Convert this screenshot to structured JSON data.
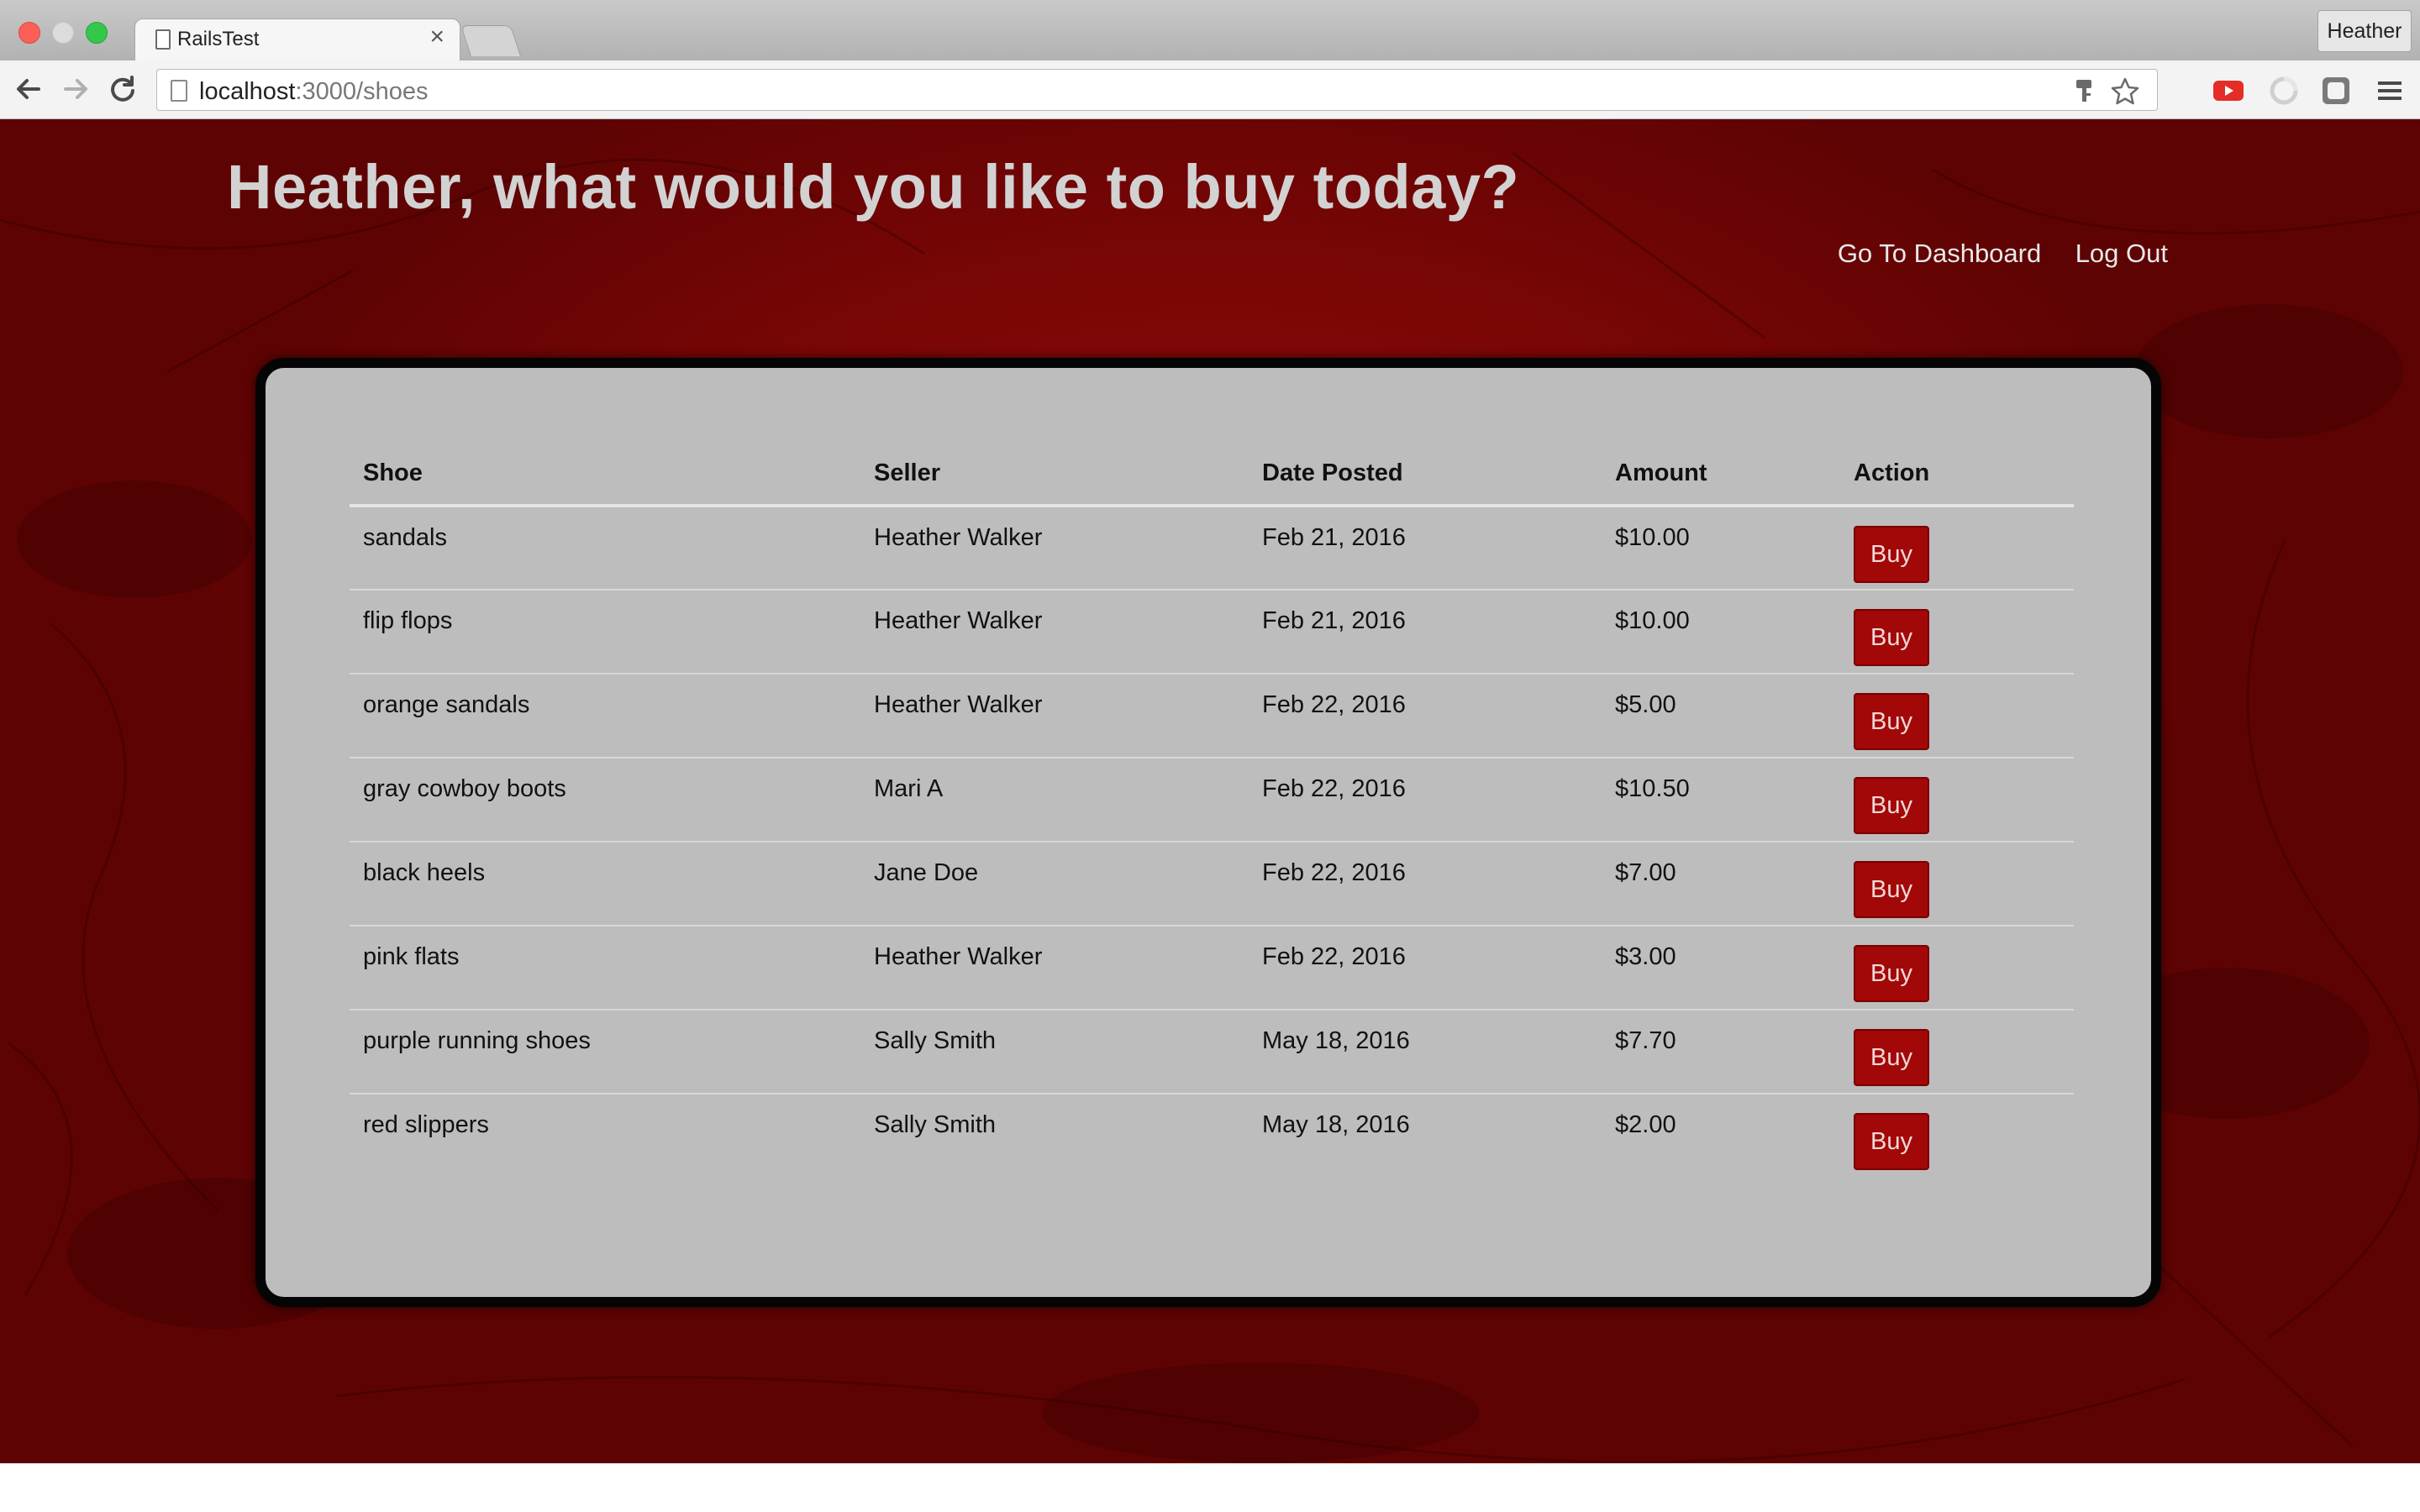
{
  "browser": {
    "tab_title": "RailsTest",
    "tab_close": "×",
    "profile_name": "Heather",
    "url_host": "localhost",
    "url_path": ":3000/shoes"
  },
  "page": {
    "heading": "Heather, what would you like to buy today?",
    "nav": {
      "dashboard": "Go To Dashboard",
      "logout": "Log Out"
    },
    "table": {
      "headers": [
        "Shoe",
        "Seller",
        "Date Posted",
        "Amount",
        "Action"
      ],
      "rows": [
        {
          "shoe": "sandals",
          "seller": "Heather Walker",
          "date": "Feb 21, 2016",
          "amount": "$10.00",
          "action": "Buy"
        },
        {
          "shoe": "flip flops",
          "seller": "Heather Walker",
          "date": "Feb 21, 2016",
          "amount": "$10.00",
          "action": "Buy"
        },
        {
          "shoe": "orange sandals",
          "seller": "Heather Walker",
          "date": "Feb 22, 2016",
          "amount": "$5.00",
          "action": "Buy"
        },
        {
          "shoe": "gray cowboy boots",
          "seller": "Mari A",
          "date": "Feb 22, 2016",
          "amount": "$10.50",
          "action": "Buy"
        },
        {
          "shoe": "black heels",
          "seller": "Jane Doe",
          "date": "Feb 22, 2016",
          "amount": "$7.00",
          "action": "Buy"
        },
        {
          "shoe": "pink flats",
          "seller": "Heather Walker",
          "date": "Feb 22, 2016",
          "amount": "$3.00",
          "action": "Buy"
        },
        {
          "shoe": "purple running shoes",
          "seller": "Sally Smith",
          "date": "May 18, 2016",
          "amount": "$7.70",
          "action": "Buy"
        },
        {
          "shoe": "red slippers",
          "seller": "Sally Smith",
          "date": "May 18, 2016",
          "amount": "$2.00",
          "action": "Buy"
        }
      ]
    }
  },
  "colors": {
    "background": "#7a0606",
    "panel": "#bdbdbd",
    "panel_border": "#050505",
    "buy_button": "#a30808",
    "heading": "#d2d2d2"
  },
  "icons": {
    "back": "back-arrow-icon",
    "forward": "forward-arrow-icon",
    "reload": "reload-icon",
    "page": "page-icon",
    "key": "key-icon",
    "star": "star-icon",
    "youtube": "youtube-icon",
    "sync": "sync-icon",
    "extension": "extension-icon",
    "menu": "hamburger-menu-icon"
  }
}
